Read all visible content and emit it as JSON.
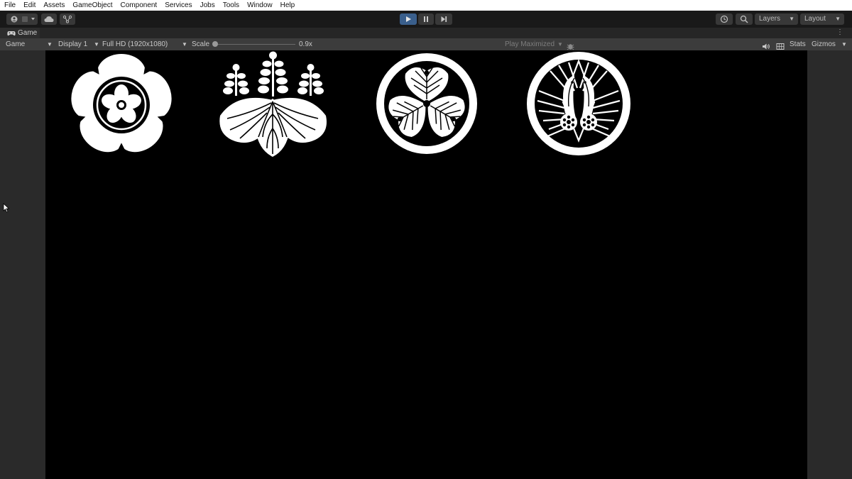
{
  "menubar": {
    "items": [
      "File",
      "Edit",
      "Assets",
      "GameObject",
      "Component",
      "Services",
      "Jobs",
      "Tools",
      "Window",
      "Help"
    ]
  },
  "toolbar": {
    "account_icon": "account-icon",
    "cloud_icon": "cloud-icon",
    "collab_icon": "collab-icon",
    "play_icon": "play-icon",
    "pause_icon": "pause-icon",
    "step_icon": "step-icon",
    "history_icon": "history-icon",
    "search_icon": "search-icon",
    "layers_label": "Layers",
    "layout_label": "Layout"
  },
  "tab": {
    "title": "Game"
  },
  "gamebar": {
    "mode": "Game",
    "display": "Display 1",
    "resolution": "Full HD (1920x1080)",
    "scale_label": "Scale",
    "scale_value": "0.9x",
    "play_mode": "Play Maximized",
    "stats_label": "Stats",
    "gizmos_label": "Gizmos"
  },
  "crests": [
    "oda-mokko-crest",
    "toyotomi-kiri-crest",
    "tokugawa-aoi-crest",
    "crane-crest"
  ],
  "colors": {
    "accent_play": "#3a5f8c",
    "viewport_bg": "#000000",
    "crest_fill": "#ffffff"
  }
}
